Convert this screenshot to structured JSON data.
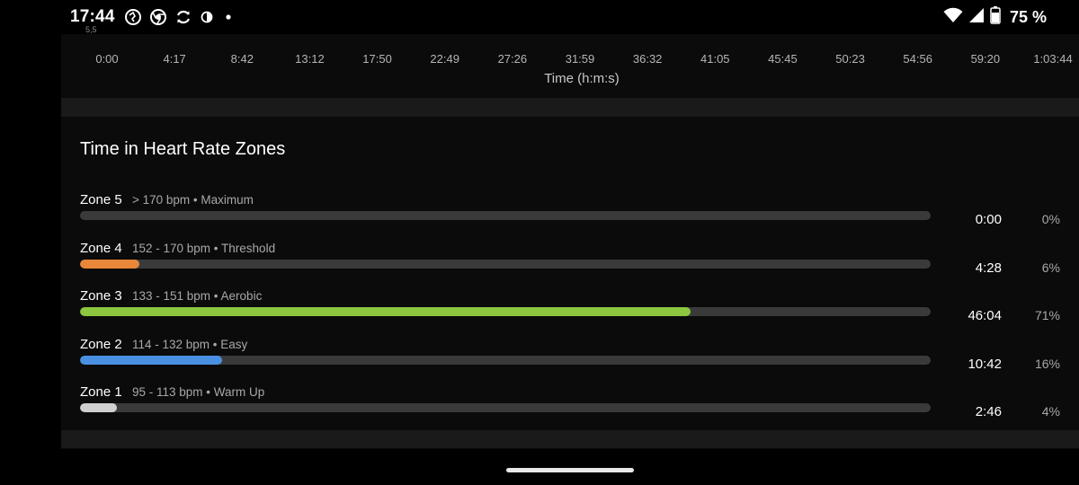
{
  "status_bar": {
    "time": "17:44",
    "battery_text": "75 %",
    "left_icons": [
      "vpn-globe-icon",
      "chrome-icon",
      "sync-icon",
      "data-saver-icon",
      "notification-dot-icon"
    ],
    "right_icons": [
      "wifi-icon",
      "cell-signal-icon",
      "battery-icon"
    ]
  },
  "chart": {
    "x_ticks": [
      "0:00",
      "4:17",
      "8:42",
      "13:12",
      "17:50",
      "22:49",
      "27:26",
      "31:59",
      "36:32",
      "41:05",
      "45:45",
      "50:23",
      "54:56",
      "59:20",
      "1:03:44"
    ],
    "x_label": "Time (h:m:s)",
    "partial_label": "5,5"
  },
  "zones_section": {
    "title": "Time in Heart Rate Zones",
    "zones": [
      {
        "name": "Zone 5",
        "desc": "> 170 bpm • Maximum",
        "time": "0:00",
        "pct": "0%",
        "fraction": 0.0,
        "color": "#888888"
      },
      {
        "name": "Zone 4",
        "desc": "152 - 170 bpm • Threshold",
        "time": "4:28",
        "pct": "6%",
        "fraction": 0.07,
        "color": "#e8873a"
      },
      {
        "name": "Zone 3",
        "desc": "133 - 151 bpm • Aerobic",
        "time": "46:04",
        "pct": "71%",
        "fraction": 0.718,
        "color": "#8dc63f"
      },
      {
        "name": "Zone 2",
        "desc": "114 - 132 bpm • Easy",
        "time": "10:42",
        "pct": "16%",
        "fraction": 0.167,
        "color": "#4a90e2"
      },
      {
        "name": "Zone 1",
        "desc": "95 - 113 bpm • Warm Up",
        "time": "2:46",
        "pct": "4%",
        "fraction": 0.043,
        "color": "#cfcfcf"
      }
    ]
  }
}
